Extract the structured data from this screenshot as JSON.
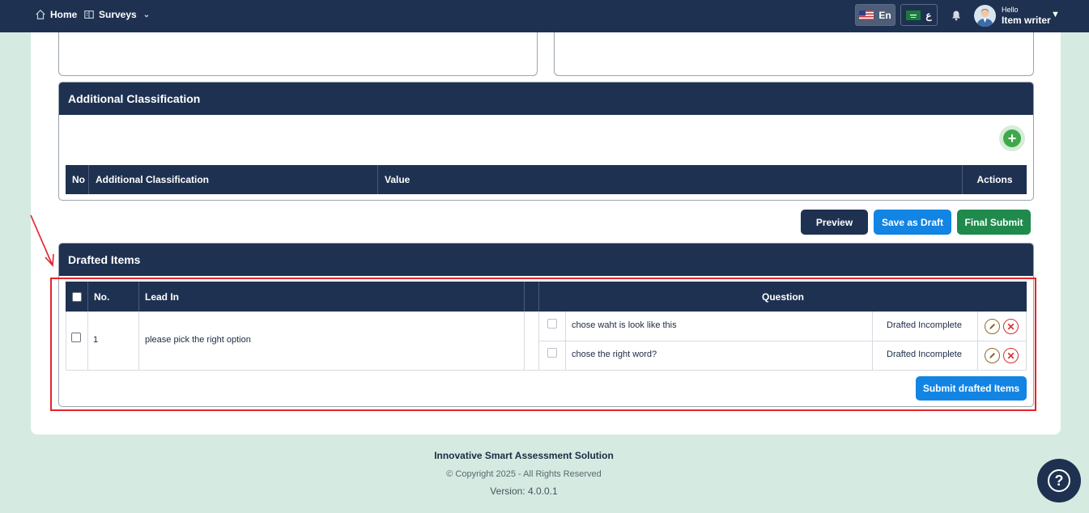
{
  "topbar": {
    "home_label": "Home",
    "surveys_label": "Surveys",
    "lang_en_label": "En",
    "lang_ar_label": "ع",
    "hello_label": "Hello",
    "user_name": "Item writer"
  },
  "additional_classification": {
    "title": "Additional Classification",
    "columns": [
      "No",
      "Additional Classification",
      "Value",
      "Actions"
    ]
  },
  "form_buttons": {
    "preview": "Preview",
    "save_draft": "Save as Draft",
    "final_submit": "Final Submit"
  },
  "drafted_items": {
    "title": "Drafted Items",
    "columns": {
      "no": "No.",
      "lead_in": "Lead In",
      "question": "Question"
    },
    "rows": [
      {
        "no": "1",
        "lead_in": "please pick the right option",
        "questions": [
          {
            "text": "chose waht is look like this",
            "status": "Drafted Incomplete"
          },
          {
            "text": "chose the right word?",
            "status": "Drafted Incomplete"
          }
        ]
      }
    ],
    "submit_label": "Submit drafted Items"
  },
  "footer": {
    "title": "Innovative Smart Assessment Solution",
    "copyright": "© Copyright 2025 - All Rights Reserved",
    "version": "Version: 4.0.0.1"
  },
  "colors": {
    "navy": "#1e3150",
    "blue": "#1284e3",
    "green": "#1f8a4c",
    "annotation_red": "#e3242b",
    "background": "#d5ebe1"
  }
}
